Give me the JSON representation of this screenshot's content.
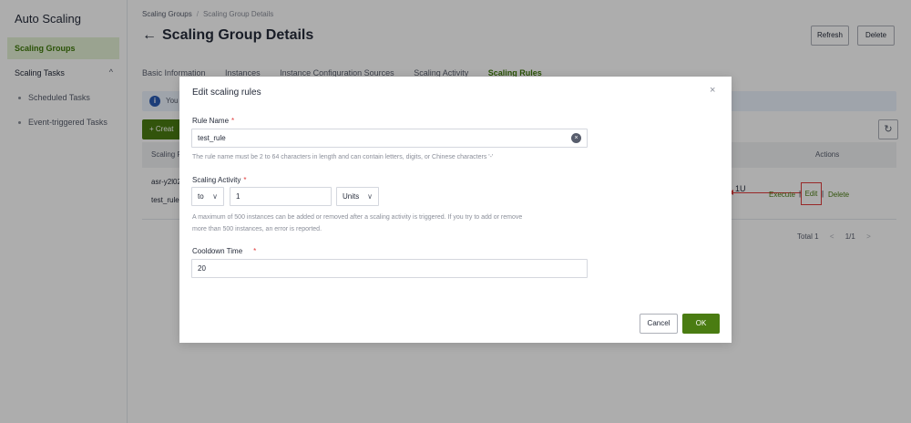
{
  "sidebar": {
    "title": "Auto Scaling",
    "active_item": "Scaling Groups",
    "group_label": "Scaling Tasks",
    "group_chevron": "^",
    "sub_items": [
      "Scheduled Tasks",
      "Event-triggered Tasks"
    ]
  },
  "breadcrumb": {
    "root": "Scaling Groups",
    "separator": "/",
    "current": "Scaling Group Details"
  },
  "header": {
    "back_icon": "←",
    "title": "Scaling Group Details",
    "refresh_label": "Refresh",
    "delete_label": "Delete"
  },
  "tabs": [
    {
      "label": "Basic Information"
    },
    {
      "label": "Instances"
    },
    {
      "label": "Instance Configuration Sources"
    },
    {
      "label": "Scaling Activity"
    },
    {
      "label": "Scaling Rules",
      "active": true
    }
  ],
  "info_bar": {
    "icon": "i",
    "text": "You c"
  },
  "toolbar": {
    "create_label": "+ Creat",
    "refresh_icon": "↻"
  },
  "table": {
    "col_name": "Scaling R",
    "col_actions": "Actions",
    "row_line1": "asr-y2l02",
    "row_line2": "test_rule",
    "row_value": "1U",
    "actions": {
      "execute": "Execute",
      "sep": "|",
      "edit": "Edit",
      "delete": "Delete"
    }
  },
  "pager": {
    "total": "Total 1",
    "prev": "<",
    "pages": "1/1",
    "next": ">"
  },
  "modal": {
    "title": "Edit scaling rules",
    "close_icon": "×",
    "rule_name_label": "Rule Name",
    "required_mark": "*",
    "rule_name_value": "test_rule",
    "clear_icon": "×",
    "rule_name_help": "The rule name must be 2 to 64 characters in length and can contain letters, digits, or Chinese characters '-'",
    "activity_label": "Scaling Activity",
    "activity_op": "to",
    "activity_value": "1",
    "activity_unit": "Units",
    "chevron": "∨",
    "activity_help_1": "A maximum of 500 instances can be added or removed after a scaling activity is triggered. If you try to add or remove",
    "activity_help_2": "more than 500 instances, an error is reported.",
    "cooldown_label": "Cooldown Time",
    "cooldown_value": "20",
    "cancel_label": "Cancel",
    "ok_label": "OK"
  }
}
